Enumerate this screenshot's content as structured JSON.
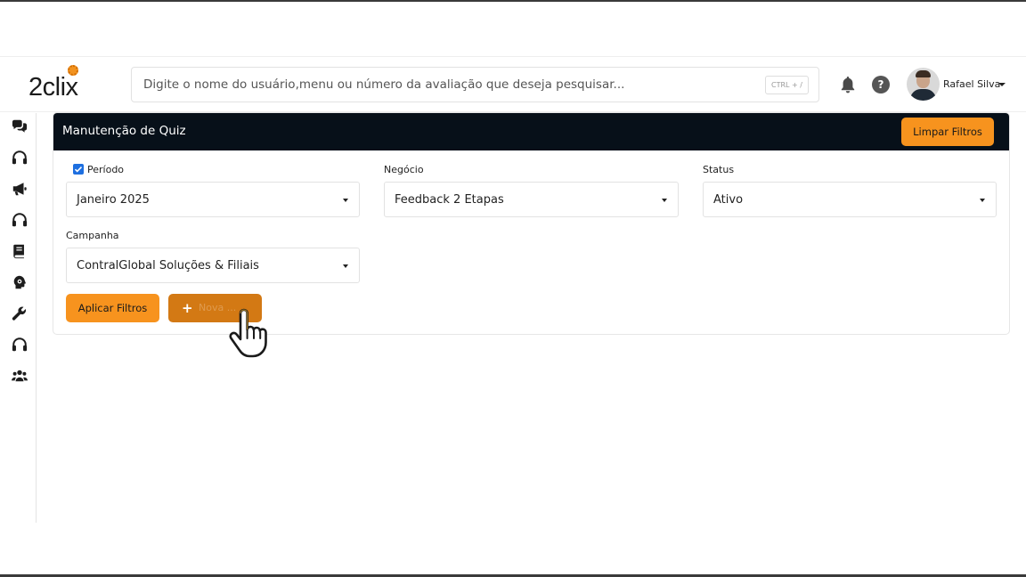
{
  "header": {
    "logo_text": "2clix",
    "search_placeholder": "Digite o nome do usuário,menu ou número da avaliação que deseja pesquisar...",
    "search_shortcut": "CTRL + /",
    "help_symbol": "?",
    "user_name": "Rafael Silva"
  },
  "sidebar": {
    "icons": [
      "chat-icon",
      "headset-icon",
      "megaphone-icon",
      "headset-icon",
      "book-icon",
      "settings-head-icon",
      "wrench-icon",
      "headset-icon",
      "users-icon"
    ]
  },
  "page": {
    "title": "Manutenção de Quiz",
    "clear_filters": "Limpar Filtros",
    "apply_filters": "Aplicar Filtros",
    "new_button": "Nova ..."
  },
  "filters": {
    "period_label": "Período",
    "period_checked": true,
    "period_value": "Janeiro 2025",
    "business_label": "Negócio",
    "business_value": "Feedback 2 Etapas",
    "status_label": "Status",
    "status_value": "Ativo",
    "campaign_label": "Campanha",
    "campaign_value": "ContralGlobal Soluções & Filiais"
  },
  "colors": {
    "accent": "#f7931e",
    "header_dark": "#071019",
    "checkbox": "#1e6fe0"
  }
}
